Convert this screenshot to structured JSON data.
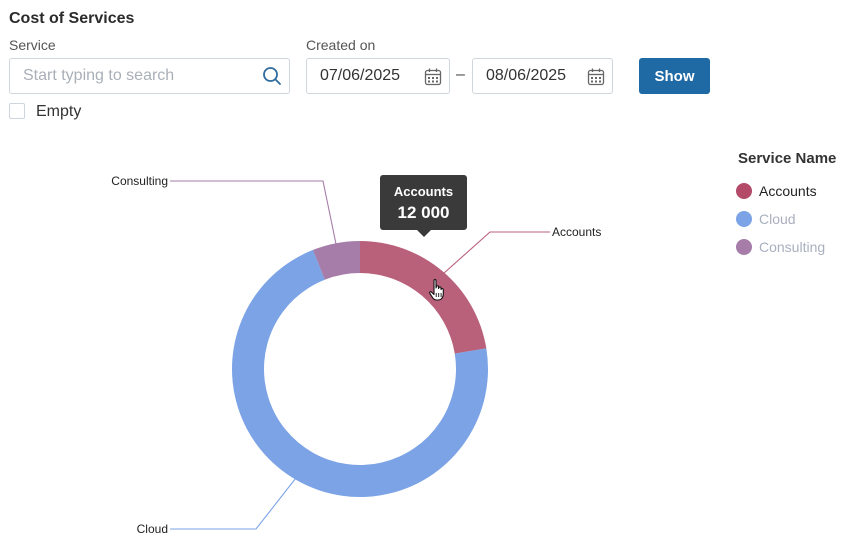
{
  "header": {
    "title": "Cost of Services"
  },
  "filters": {
    "service_label": "Service",
    "service_placeholder": "Start typing to search",
    "created_label": "Created on",
    "date_from": "07/06/2025",
    "date_separator": "–",
    "date_to": "08/06/2025",
    "show_label": "Show",
    "empty_label": "Empty",
    "empty_checked": false
  },
  "legend": {
    "title": "Service Name",
    "items": [
      {
        "label": "Accounts",
        "color": "#b24a68",
        "active": true
      },
      {
        "label": "Cloud",
        "color": "#7ba3e6",
        "active": false
      },
      {
        "label": "Consulting",
        "color": "#a67ca8",
        "active": false
      }
    ]
  },
  "tooltip": {
    "name": "Accounts",
    "value": "12 000"
  },
  "chart_data": {
    "type": "pie",
    "style": "donut",
    "series": [
      {
        "name": "Accounts",
        "value": 12000,
        "color": "#b9607a"
      },
      {
        "name": "Cloud",
        "value": 38300,
        "color": "#7ba3e6"
      },
      {
        "name": "Consulting",
        "value": 3200,
        "color": "#a67ca8"
      }
    ],
    "legend_title": "Service Name",
    "legend_position": "right",
    "highlighted": "Accounts"
  }
}
